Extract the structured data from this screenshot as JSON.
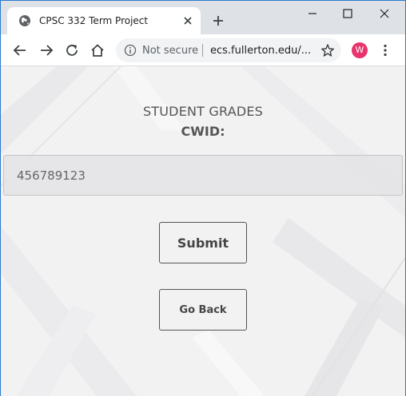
{
  "browser": {
    "tab_title": "CPSC 332 Term Project",
    "security_label": "Not secure",
    "url_text": "ecs.fullerton.edu/...",
    "profile_initial": "W",
    "profile_color": "#e8336d",
    "accent_border": "#2b79d0"
  },
  "icons": {
    "favicon": "globe-icon",
    "tab_close": "close-icon",
    "new_tab": "plus-icon",
    "back": "arrow-left-icon",
    "forward": "arrow-right-icon",
    "reload": "reload-icon",
    "home": "home-icon",
    "info": "info-icon",
    "bookmark": "star-icon",
    "menu": "kebab-menu-icon"
  },
  "page": {
    "heading": "STUDENT GRADES",
    "cwid_label": "CWID:",
    "cwid_value": "456789123",
    "submit_label": "Submit",
    "go_back_label": "Go Back"
  }
}
